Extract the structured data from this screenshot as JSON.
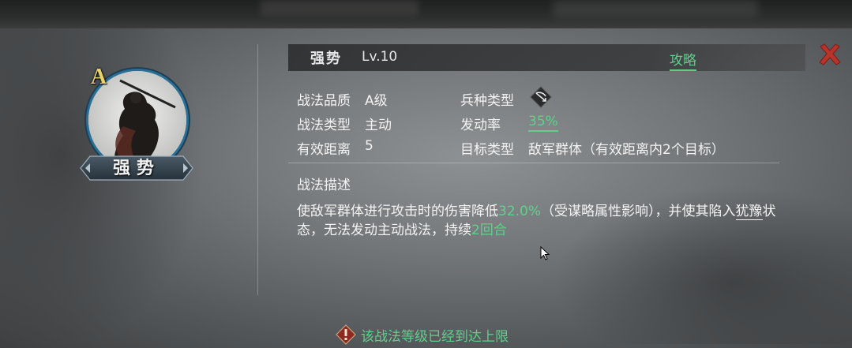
{
  "skill": {
    "name": "强势",
    "level": "Lv.10",
    "grade": "A",
    "guide_label": "攻略"
  },
  "attributes": {
    "quality_label": "战法品质",
    "quality_value": "A级",
    "type_label": "战法类型",
    "type_value": "主动",
    "range_label": "有效距离",
    "range_value": "5",
    "troop_label": "兵种类型",
    "troop_icon": "bow-icon",
    "rate_label": "发动率",
    "rate_value": "35%",
    "target_label": "目标类型",
    "target_value": "敌军群体（有效距离内2个目标）"
  },
  "description": {
    "title": "战法描述",
    "part1": "使敌军群体进行攻击时的伤害降低",
    "highlight1": "32.0%",
    "part2": "（受谋略属性影响），并使其陷入",
    "link": "犹豫",
    "part3": "状态，无法发动主动战法，持续",
    "highlight2": "2回合"
  },
  "footer": {
    "message": "该战法等级已经到达上限"
  },
  "colors": {
    "accent_green": "#5fd08c",
    "close_red": "#c0392b",
    "grade_gold": "#e8d36a",
    "portrait_ring": "#2a6f95"
  }
}
